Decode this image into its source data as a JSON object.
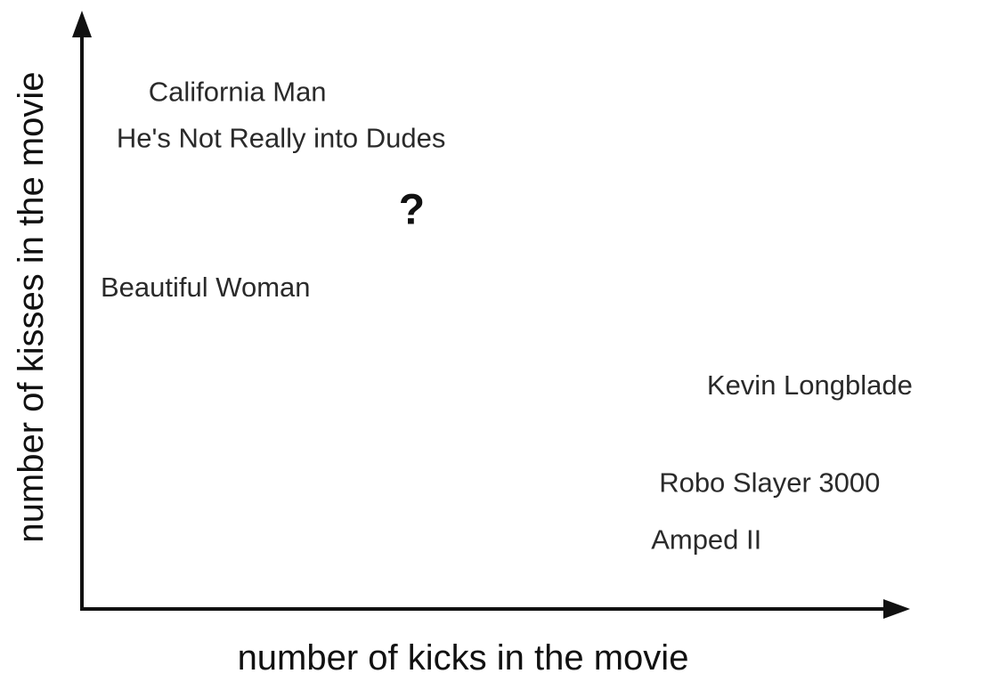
{
  "chart_data": {
    "type": "scatter",
    "xlabel": "number of kicks in the movie",
    "ylabel": "number of kisses in the movie",
    "xlim": [
      0,
      100
    ],
    "ylim": [
      0,
      100
    ],
    "grid": false,
    "points": [
      {
        "label": "California Man",
        "x": 7,
        "y": 93
      },
      {
        "label": "He's Not Really into Dudes",
        "x": 3,
        "y": 84
      },
      {
        "label": "Beautiful Woman",
        "x": 1,
        "y": 55
      },
      {
        "label": "Kevin Longblade",
        "x": 77,
        "y": 36
      },
      {
        "label": "Robo Slayer 3000",
        "x": 71,
        "y": 17
      },
      {
        "label": "Amped II",
        "x": 70,
        "y": 6
      }
    ],
    "query_point": {
      "label": "?",
      "x": 40,
      "y": 70
    }
  }
}
